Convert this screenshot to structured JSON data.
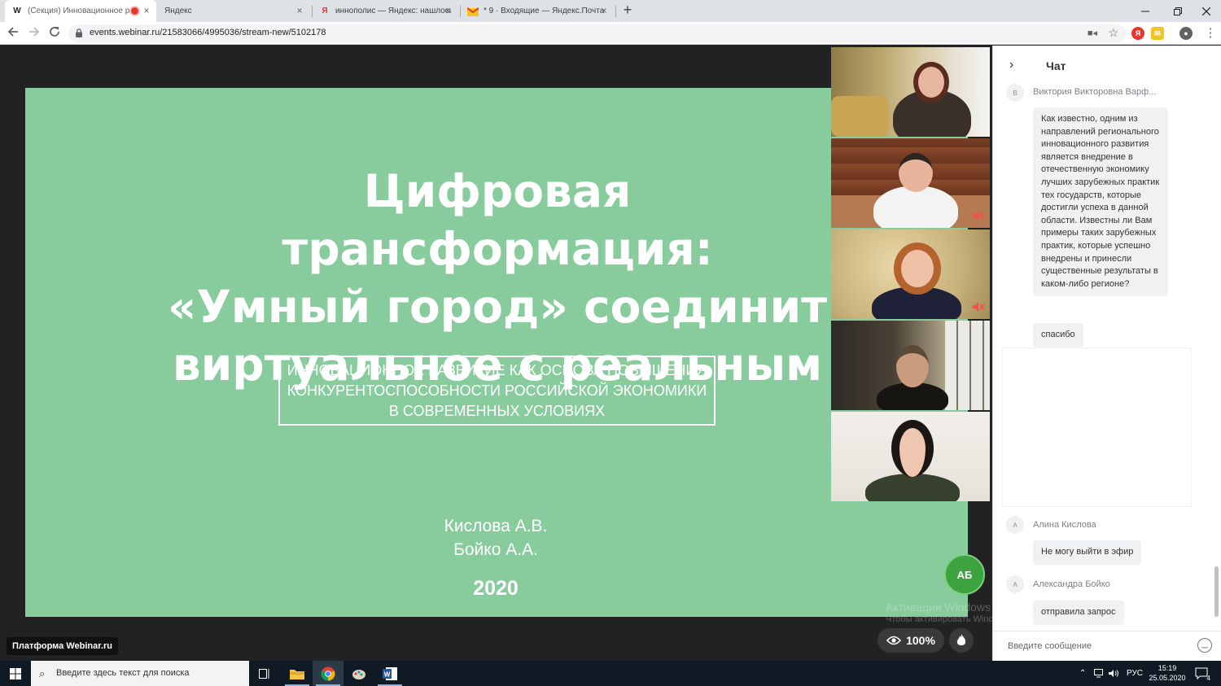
{
  "browser": {
    "tabs": [
      {
        "title": "(Секция) Инновационное р",
        "favicon": "webinar-w-icon",
        "favicon_text": "W",
        "active": true
      },
      {
        "title": "Яндекс",
        "favicon": "none",
        "active": false
      },
      {
        "title": "иннополис — Яндекс: нашлось",
        "favicon": "yandex-y-icon",
        "favicon_text": "Я",
        "active": false
      },
      {
        "title": "* 9 · Входящие — Яндекс.Почта",
        "favicon": "yandex-mail-icon",
        "active": false
      }
    ],
    "url": "events.webinar.ru/21583066/4995036/stream-new/5102178",
    "colors": {
      "tabstrip": "#dee1e6",
      "accent_recording": "#e8362b"
    }
  },
  "slide": {
    "title_lines": [
      "Цифровая трансформация:",
      "«Умный город» соединит",
      "виртуальное с реальным"
    ],
    "subtitle": "ИННОВАЦИОННОЕ РАЗВИТИЕ КАК ОСНОВА ПОВЫШЕНИЯ КОНКУРЕНТОСПОСОБНОСТИ РОССИЙСКОЙ ЭКОНОМИКИ В СОВРЕМЕННЫХ УСЛОВИЯХ",
    "authors": [
      "Кислова А.В.",
      "Бойко А.А."
    ],
    "year": "2020",
    "background_color": "#88cc9d"
  },
  "participants": [
    {
      "muted": false
    },
    {
      "muted": true
    },
    {
      "muted": true
    },
    {
      "muted": false
    },
    {
      "muted": false
    }
  ],
  "speaker_avatar": "АБ",
  "platform_badge": "Платформа Webinar.ru",
  "viewers": {
    "zoom": "100%"
  },
  "watermark": {
    "line1": "Активация Windows",
    "line2": "Чтобы активировать Windows, перейдите в раздел \"Параметры\"."
  },
  "chat": {
    "title": "Чат",
    "messages": [
      {
        "initial": "В",
        "author": "Виктория Викторовна Варф...",
        "texts": [
          "Как известно, одним из направлений регионального инновационного развития является внедрение в отечественную экономику лучших зарубежных практик тех государств, которые достигли успеха в данной области. Известны ли Вам примеры таких зарубежных практик, которые успешно внедрены и принесли существенные результаты в каком-либо регионе?",
          "спасибо"
        ]
      },
      {
        "initial": "А",
        "author": "Алина Кислова",
        "texts": [
          "Не могу выйти в эфир"
        ]
      },
      {
        "initial": "А",
        "author": "Александра Бойко",
        "texts": [
          "отправила запрос"
        ]
      }
    ],
    "input_placeholder": "Введите сообщение"
  },
  "taskbar": {
    "search_placeholder": "Введите здесь текст для поиска",
    "language": "РУС",
    "time": "15:19",
    "date": "25.05.2020",
    "notifications": "4"
  }
}
